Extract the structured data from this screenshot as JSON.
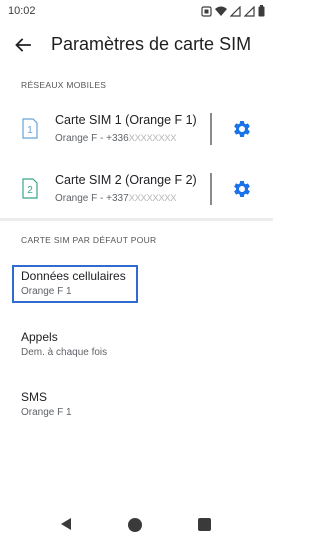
{
  "status_bar": {
    "time": "10:02"
  },
  "header": {
    "title": "Paramètres de carte SIM"
  },
  "mobile_networks": {
    "header": "RÉSEAUX MOBILES",
    "sims": [
      {
        "slot_number": "1",
        "title": "Carte SIM 1 (Orange F 1)",
        "subtitle_prefix": "Orange F - +336",
        "subtitle_masked": "XXXXXXXX",
        "accent_color": "#6aa3d8"
      },
      {
        "slot_number": "2",
        "title": "Carte SIM 2 (Orange F 2)",
        "subtitle_prefix": "Orange F - +337",
        "subtitle_masked": "XXXXXXXX",
        "accent_color": "#3aa58a"
      }
    ],
    "gear_color": "#1a73e8"
  },
  "default_sim": {
    "header": "CARTE SIM PAR DÉFAUT POUR",
    "items": [
      {
        "title": "Données cellulaires",
        "subtitle": "Orange F 1"
      },
      {
        "title": "Appels",
        "subtitle": "Dem. à chaque fois"
      },
      {
        "title": "SMS",
        "subtitle": "Orange F 1"
      }
    ]
  }
}
